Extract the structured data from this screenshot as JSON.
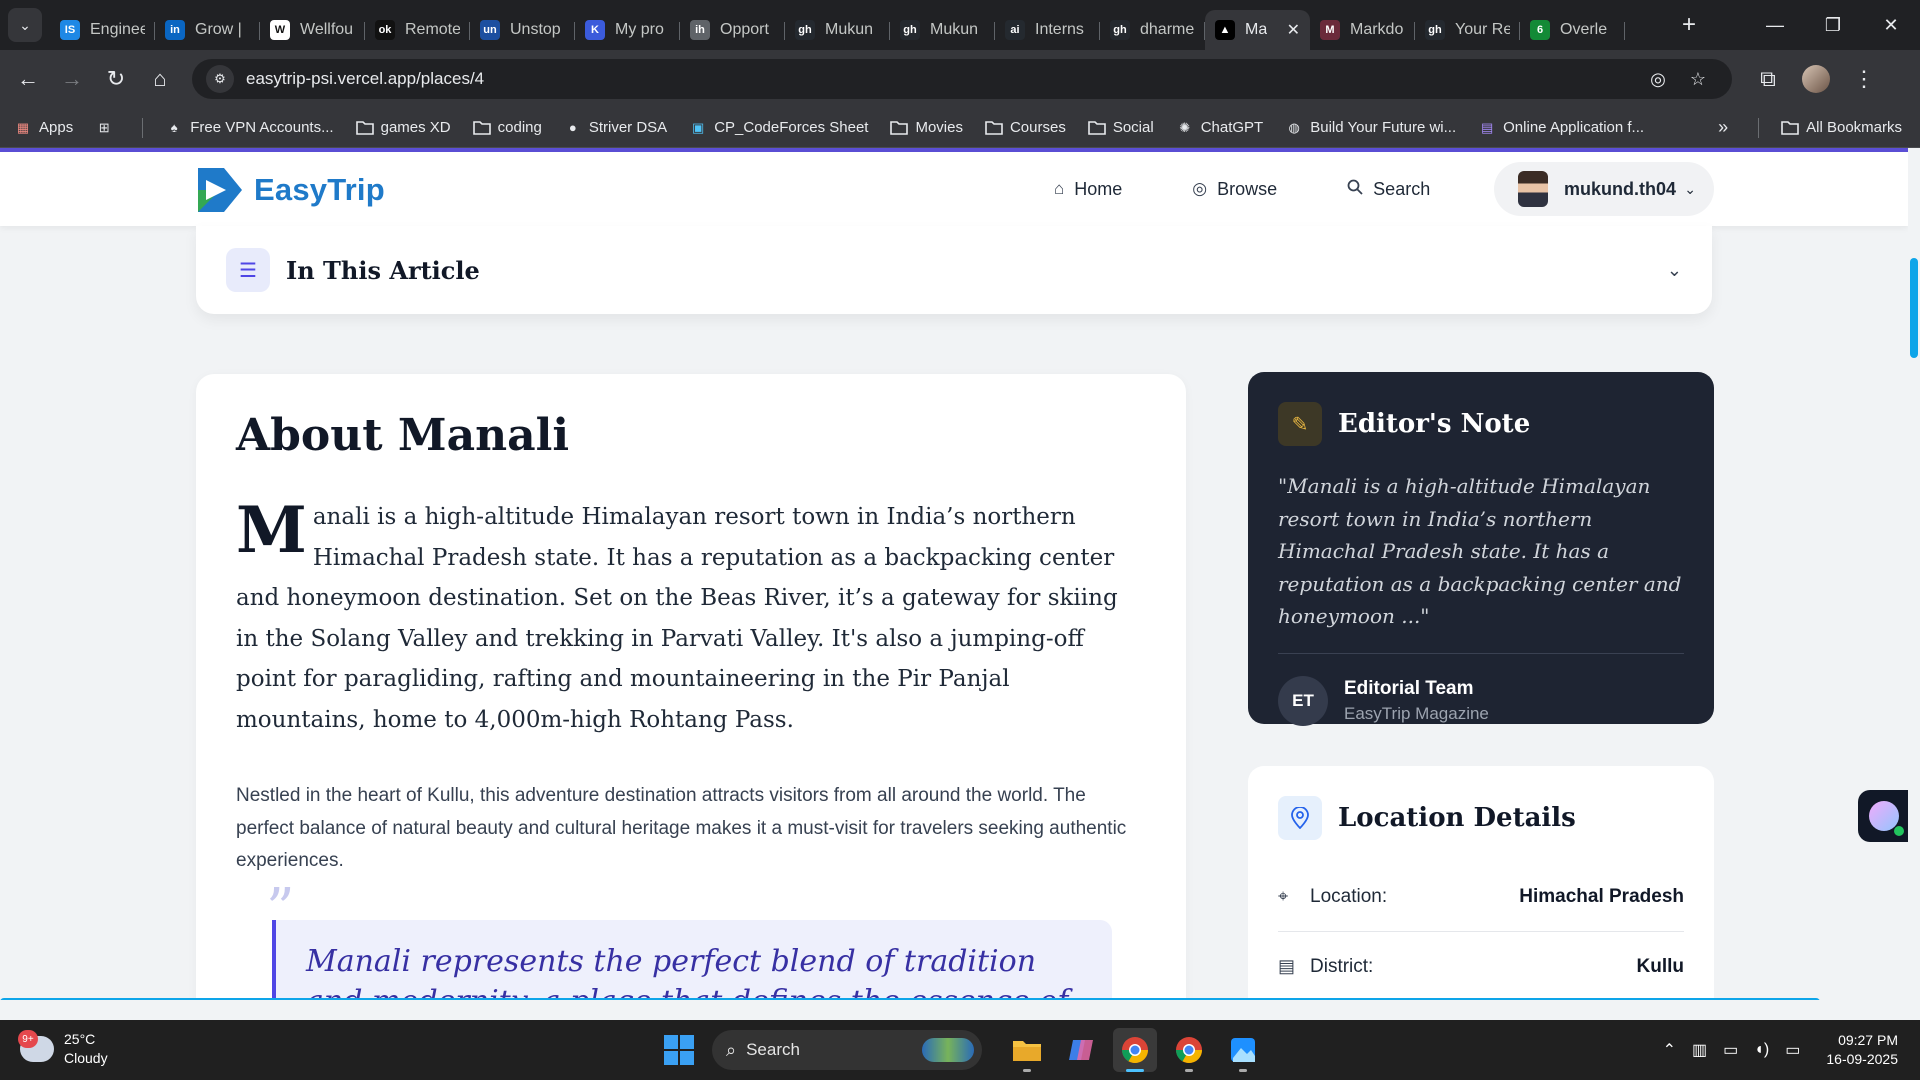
{
  "browser": {
    "tabs": [
      {
        "title": "Enginee",
        "color": "#1e88e5",
        "glyph": "IS"
      },
      {
        "title": "Grow |",
        "color": "#0a66c2",
        "glyph": "in"
      },
      {
        "title": "Wellfou",
        "color": "#ffffff",
        "glyph": "W"
      },
      {
        "title": "Remote",
        "color": "#111111",
        "glyph": "ok"
      },
      {
        "title": "Unstop",
        "color": "#1c4fa0",
        "glyph": "un"
      },
      {
        "title": "My pro",
        "color": "#3b5bdb",
        "glyph": "K"
      },
      {
        "title": "Opport",
        "color": "#5f6368",
        "glyph": "ih"
      },
      {
        "title": "Mukun",
        "color": "#24292f",
        "glyph": "gh"
      },
      {
        "title": "Mukun",
        "color": "#24292f",
        "glyph": "gh"
      },
      {
        "title": "Interns",
        "color": "#24292f",
        "glyph": "ai"
      },
      {
        "title": "dharme",
        "color": "#24292f",
        "glyph": "gh"
      },
      {
        "title": "Ma",
        "color": "#000000",
        "glyph": "▲",
        "active": true
      },
      {
        "title": "Markdo",
        "color": "#6b2a3a",
        "glyph": "M"
      },
      {
        "title": "Your Re",
        "color": "#24292f",
        "glyph": "gh"
      },
      {
        "title": "Overle",
        "color": "#138a36",
        "glyph": "6"
      }
    ],
    "url": "easytrip-psi.vercel.app/places/4",
    "bookmarks": [
      {
        "label": "Apps",
        "icon": "apps-grid-icon"
      },
      {
        "label": "",
        "icon": "tab-groups-icon"
      },
      {
        "label": "Free VPN Accounts...",
        "icon": "vpn-icon"
      },
      {
        "label": "games XD",
        "icon": "folder-icon"
      },
      {
        "label": "coding",
        "icon": "folder-icon"
      },
      {
        "label": "Striver DSA",
        "icon": "tuf-icon"
      },
      {
        "label": "CP_CodeForces Sheet",
        "icon": "sheet-icon"
      },
      {
        "label": "Movies",
        "icon": "folder-icon"
      },
      {
        "label": "Courses",
        "icon": "folder-icon"
      },
      {
        "label": "Social",
        "icon": "folder-icon"
      },
      {
        "label": "ChatGPT",
        "icon": "openai-icon"
      },
      {
        "label": "Build Your Future wi...",
        "icon": "globe-icon"
      },
      {
        "label": "Online Application f...",
        "icon": "form-icon"
      }
    ],
    "all_bookmarks": "All Bookmarks"
  },
  "site": {
    "brand": "EasyTrip",
    "nav": {
      "home": "Home",
      "browse": "Browse",
      "search": "Search"
    },
    "user": "mukund.th04"
  },
  "toc": {
    "title": "In This Article"
  },
  "article": {
    "title": "About Manali",
    "dropcap": "M",
    "lead": "anali is a high-altitude Himalayan resort town in India’s northern Himachal Pradesh state. It has a reputation as a backpacking center and honeymoon destination. Set on the Beas River, it’s a gateway for skiing in the Solang Valley and trekking in Parvati Valley. It's also a jumping-off point for paragliding, rafting and mountaineering in the Pir Panjal mountains, home to 4,000m-high Rohtang Pass.",
    "body": "Nestled in the heart of Kullu, this adventure destination attracts visitors from all around the world. The perfect balance of natural beauty and cultural heritage makes it a must-visit for travelers seeking authentic experiences.",
    "quote_mark": "”",
    "quote": "Manali represents the perfect blend of tradition and modernity, a place that defines the essence of Himachal Pradesh."
  },
  "editor_note": {
    "title": "Editor's Note",
    "quote": "\"Manali is a high-altitude Himalayan resort town in India’s northern Himachal Pradesh state. It has a reputation as a backpacking center and honeymoon ...\"",
    "initials": "ET",
    "author": "Editorial Team",
    "org": "EasyTrip Magazine"
  },
  "location_details": {
    "title": "Location Details",
    "rows": [
      {
        "label": "Location:",
        "value": "Himachal Pradesh",
        "icon": "map-pin-icon"
      },
      {
        "label": "District:",
        "value": "Kullu",
        "icon": "map-icon"
      }
    ]
  },
  "taskbar": {
    "weather_temp": "25°C",
    "weather_desc": "Cloudy",
    "weather_badge": "9+",
    "search": "Search",
    "time": "09:27 PM",
    "date": "16-09-2025"
  },
  "colors": {
    "brand": "#1f7ac9",
    "accent": "#4f46e5",
    "editor_bg": "#1e2432",
    "progress": "#0ea5e9"
  }
}
